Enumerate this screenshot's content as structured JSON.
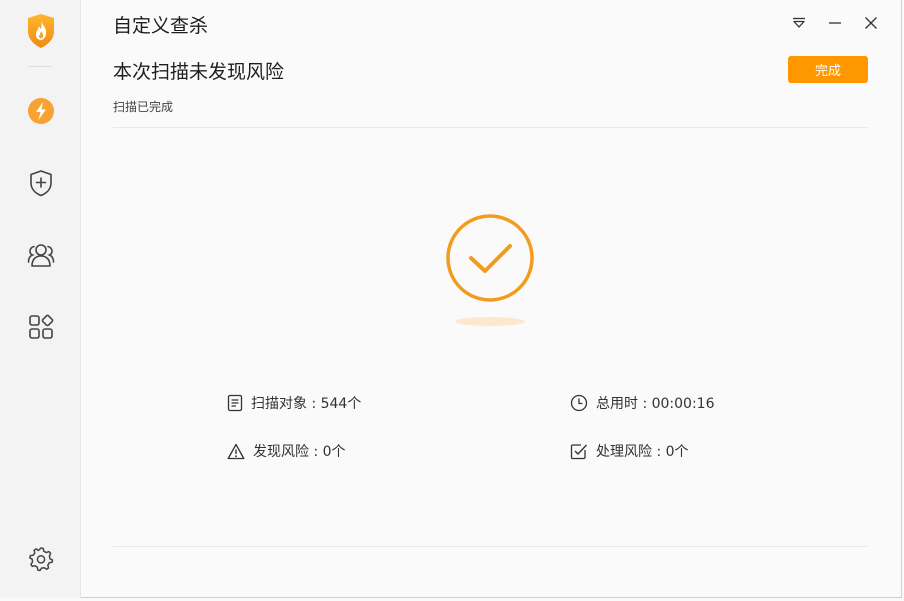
{
  "window": {
    "title": "自定义查杀"
  },
  "sidebar": {
    "items": [
      {
        "name": "speed-icon",
        "active": true
      },
      {
        "name": "shield-plus-icon",
        "active": false
      },
      {
        "name": "users-icon",
        "active": false
      },
      {
        "name": "apps-icon",
        "active": false
      }
    ],
    "settings_icon": "gear-icon"
  },
  "scan": {
    "heading": "本次扫描未发现风险",
    "status": "扫描已完成",
    "done_label": "完成"
  },
  "stats": {
    "scanned": "扫描对象 : 544个",
    "duration": "总用时 : 00:00:16",
    "found": "发现风险 : 0个",
    "handled": "处理风险 : 0个"
  },
  "colors": {
    "accent": "#ff9800",
    "brand_orange": "#f5a623"
  }
}
